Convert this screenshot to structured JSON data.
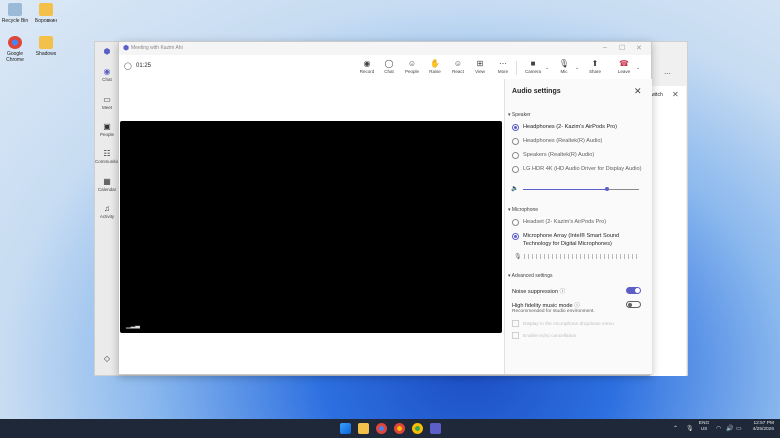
{
  "desktop": {
    "icons": [
      {
        "label": "Recycle Bin",
        "icon": "recycle-bin-icon",
        "color": "#9bbad8"
      },
      {
        "label": "Боровкин",
        "icon": "folder-icon",
        "color": "#f3c14a"
      },
      {
        "label": "Google Chrome",
        "icon": "chrome-icon",
        "color": "#e0453a"
      },
      {
        "label": "Shadows",
        "icon": "folder-icon",
        "color": "#f3c14a"
      }
    ]
  },
  "teams_back": {
    "rail": [
      {
        "label": "Chat",
        "icon": "chat-icon",
        "active": true
      },
      {
        "label": "Meet",
        "icon": "video-icon"
      },
      {
        "label": "People",
        "icon": "people-icon"
      },
      {
        "label": "Communities",
        "icon": "communities-icon"
      },
      {
        "label": "Calendar",
        "icon": "calendar-icon"
      },
      {
        "label": "Activity",
        "icon": "bell-icon"
      }
    ],
    "switch_label": "Switch"
  },
  "meeting": {
    "window_title": "Meeting with Kazim Ahi",
    "timer": "01:25",
    "toolbar": {
      "record": "Record",
      "chat": "Chat",
      "people": "People",
      "raise": "Raise",
      "react": "React",
      "view": "View",
      "more": "More",
      "camera": "Camera",
      "mic": "Mic",
      "share": "Share",
      "leave": "Leave"
    }
  },
  "audio_settings": {
    "title": "Audio settings",
    "speaker_section": "Speaker",
    "speakers": [
      {
        "label": "Headphones (2- Kazim's AirPods Pro)",
        "selected": true
      },
      {
        "label": "Headphones (Realtek(R) Audio)",
        "selected": false
      },
      {
        "label": "Speakers (Realtek(R) Audio)",
        "selected": false
      },
      {
        "label": "LG HDR 4K (HD Audio Driver for Display Audio)",
        "selected": false
      }
    ],
    "speaker_volume": 0.72,
    "microphone_section": "Microphone",
    "microphones": [
      {
        "label": "Headset (2- Kazim's AirPods Pro)",
        "selected": false
      },
      {
        "label": "Microphone Array (Intel® Smart Sound Technology for Digital Microphones)",
        "selected": true
      }
    ],
    "advanced_section": "Advanced settings",
    "noise_suppression": {
      "label": "Noise suppression",
      "on": true
    },
    "hifi_music": {
      "label": "High fidelity music mode",
      "sub": "Recommended for studio environment.",
      "on": false
    },
    "display_in_dropdown": "Display in the microphone dropdown menu",
    "echo_cancellation": "Enable echo cancellation"
  },
  "taskbar": {
    "lang": "ENG",
    "region": "US",
    "time": "12:57 PM",
    "date": "4/25/2026"
  },
  "colors": {
    "accent": "#5b5fc7",
    "leave": "#c4314b",
    "taskbar": "#1f2838"
  }
}
